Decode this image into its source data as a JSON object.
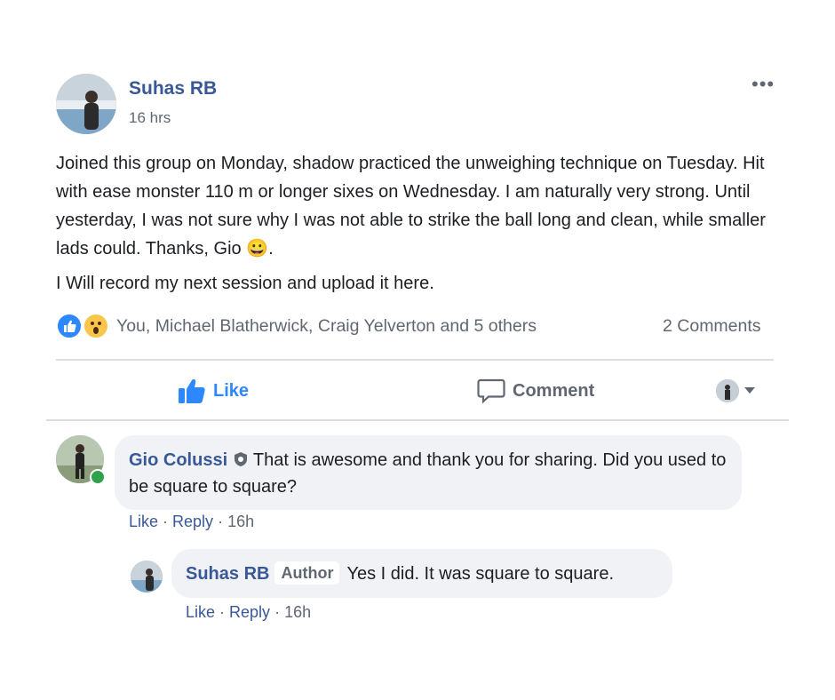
{
  "post": {
    "author": "Suhas RB",
    "time": "16 hrs",
    "more_label": "•••",
    "text_line1": "Joined this group on Monday, shadow practiced the unweighing technique on Tuesday. Hit with ease monster 110 m or longer sixes on Wednesday. I am naturally very strong. Until yesterday, I was not sure why I was not able to strike the ball long and clean, while smaller lads could. Thanks, Gio",
    "text_emoji": "😀",
    "text_line1_end": ".",
    "text_line2": "I Will record my next session and upload it here."
  },
  "reactions": {
    "icons": [
      "like-icon",
      "wow-icon"
    ],
    "summary": "You, Michael Blatherwick, Craig Yelverton and 5 others",
    "comments_count": "2 Comments"
  },
  "actions": {
    "like_label": "Like",
    "comment_label": "Comment"
  },
  "comments": [
    {
      "author": "Gio Colussi",
      "text": "That is awesome and thank you for sharing. Did you used to be square to square?",
      "like": "Like",
      "reply": "Reply",
      "time": "16h"
    },
    {
      "author": "Suhas RB",
      "badge": "Author",
      "text": "Yes I did. It was square to square.",
      "like": "Like",
      "reply": "Reply",
      "time": "16h"
    }
  ],
  "colors": {
    "link_blue": "#385898",
    "like_blue": "#2d88ff",
    "muted_gray": "#606770",
    "bubble_bg": "#f0f2f5",
    "online_green": "#31a24c"
  }
}
